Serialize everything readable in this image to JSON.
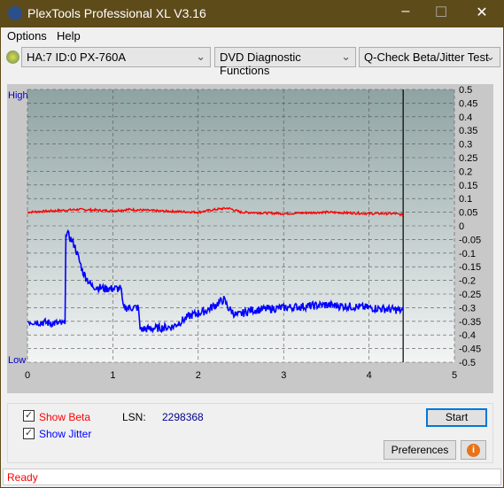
{
  "window": {
    "title": "PlexTools Professional XL V3.16",
    "logo_text": "XL"
  },
  "menu": [
    {
      "label": "Options"
    },
    {
      "label": "Help"
    }
  ],
  "toolbar": {
    "drive": "HA:7 ID:0  PX-760A",
    "function": "DVD Diagnostic Functions",
    "test": "Q-Check Beta/Jitter Test"
  },
  "chart_data": {
    "type": "line",
    "left_labels": {
      "high": "High",
      "low": "Low"
    },
    "xlim": [
      0,
      5
    ],
    "x_ticks": [
      "0",
      "1",
      "2",
      "3",
      "4",
      "5"
    ],
    "ylim": [
      -0.5,
      0.5
    ],
    "y_ticks": [
      "0.5",
      "0.45",
      "0.4",
      "0.35",
      "0.3",
      "0.25",
      "0.2",
      "0.15",
      "0.1",
      "0.05",
      "0",
      "-0.05",
      "-0.1",
      "-0.15",
      "-0.2",
      "-0.25",
      "-0.3",
      "-0.35",
      "-0.4",
      "-0.45",
      "-0.5"
    ],
    "grid": true,
    "end_marker_x": 4.4,
    "series": [
      {
        "key": "beta",
        "color": "#ff0000",
        "points": [
          [
            0,
            0.05
          ],
          [
            0.3,
            0.055
          ],
          [
            0.6,
            0.06
          ],
          [
            1.0,
            0.055
          ],
          [
            1.2,
            0.06
          ],
          [
            1.5,
            0.055
          ],
          [
            2.0,
            0.05
          ],
          [
            2.2,
            0.06
          ],
          [
            2.35,
            0.065
          ],
          [
            2.5,
            0.05
          ],
          [
            3.0,
            0.045
          ],
          [
            3.5,
            0.05
          ],
          [
            4.0,
            0.045
          ],
          [
            4.3,
            0.045
          ],
          [
            4.4,
            0.04
          ]
        ]
      },
      {
        "key": "jitter",
        "color": "#0000ff",
        "points": [
          [
            0,
            -0.35
          ],
          [
            0.44,
            -0.36
          ],
          [
            0.45,
            -0.02
          ],
          [
            0.55,
            -0.07
          ],
          [
            0.65,
            -0.17
          ],
          [
            0.75,
            -0.22
          ],
          [
            0.9,
            -0.23
          ],
          [
            1.1,
            -0.23
          ],
          [
            1.12,
            -0.3
          ],
          [
            1.3,
            -0.3
          ],
          [
            1.32,
            -0.38
          ],
          [
            1.7,
            -0.37
          ],
          [
            1.9,
            -0.33
          ],
          [
            2.1,
            -0.31
          ],
          [
            2.3,
            -0.27
          ],
          [
            2.35,
            -0.3
          ],
          [
            2.45,
            -0.33
          ],
          [
            2.6,
            -0.31
          ],
          [
            3.0,
            -0.3
          ],
          [
            3.5,
            -0.29
          ],
          [
            4.0,
            -0.3
          ],
          [
            4.4,
            -0.31
          ]
        ]
      }
    ]
  },
  "controls": {
    "show_beta": "Show Beta",
    "show_jitter": "Show Jitter",
    "lsn_label": "LSN:",
    "lsn_value": "2298368",
    "start": "Start",
    "preferences": "Preferences",
    "info": "i"
  },
  "status": "Ready"
}
